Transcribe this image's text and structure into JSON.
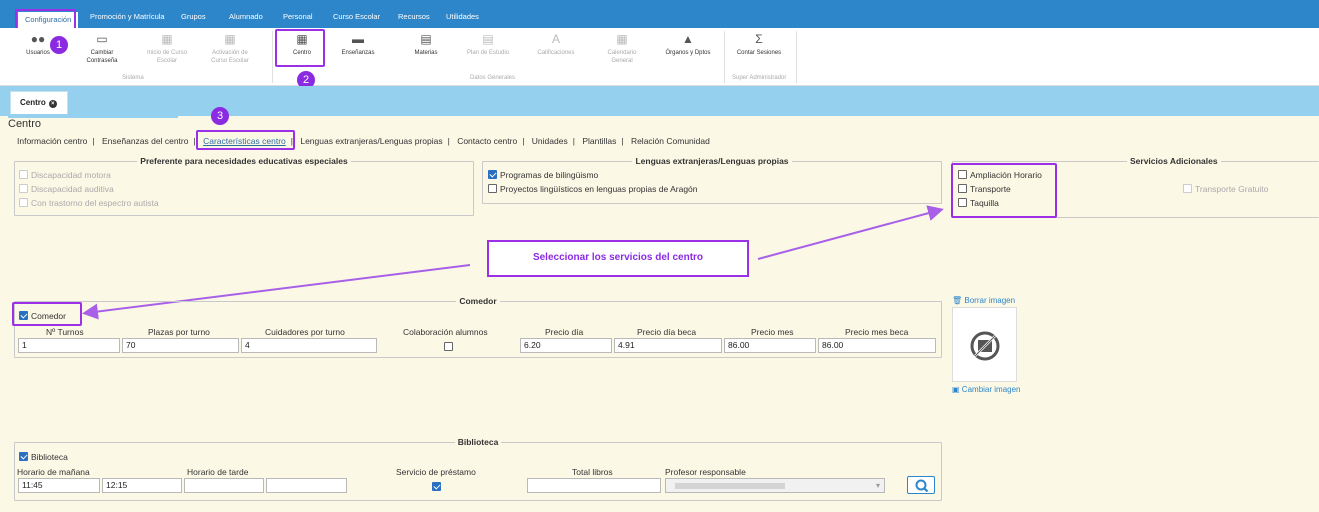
{
  "menu": {
    "items": [
      "Configuración",
      "Promoción y Matrícula",
      "Grupos",
      "Alumnado",
      "Personal",
      "Curso Escolar",
      "Recursos",
      "Utilidades"
    ]
  },
  "ribbon": {
    "usuarios": "Usuarios",
    "cambiar": [
      "Cambiar",
      "Contraseña"
    ],
    "inicio": [
      "Inicio de Curso",
      "Escolar"
    ],
    "activacion": [
      "Activación de",
      "Curso Escolar"
    ],
    "centro": "Centro",
    "ensenanzas": "Enseñanzas",
    "materias": "Materias",
    "plan": "Plan de Estudio",
    "calificaciones": "Calificaciones",
    "calendario": [
      "Calendario",
      "General"
    ],
    "organos": "Órganos y Dptos",
    "contar": "Contar Sesiones",
    "group_sistema": "Sistema",
    "group_datos": "Datos Generales",
    "group_super": "Super Administrador"
  },
  "annotations": {
    "step1": "1",
    "step2": "2",
    "step3": "3",
    "callout": "Seleccionar los servicios del centro"
  },
  "tab": {
    "label": "Centro"
  },
  "page": {
    "title": "Centro"
  },
  "subtabs": [
    "Información centro",
    "Enseñanzas del centro",
    "Características centro",
    "Lenguas extranjeras/Lenguas propias",
    "Contacto centro",
    "Unidades",
    "Plantillas",
    "Relación Comunidad"
  ],
  "nee": {
    "legend": "Preferente para necesidades educativas especiales",
    "items": [
      "Discapacidad motora",
      "Discapacidad auditiva",
      "Con trastorno del espectro autista"
    ]
  },
  "lenguas": {
    "legend": "Lenguas extranjeras/Lenguas propias",
    "items": [
      "Programas de bilingüismo",
      "Proyectos lingüísticos en lenguas propias de Aragón"
    ],
    "checked": [
      true,
      false
    ]
  },
  "servicios": {
    "legend": "Servicios Adicionales",
    "items": [
      "Ampliación Horario",
      "Transporte",
      "Taquilla"
    ],
    "transporte_gratuito": "Transporte Gratuito"
  },
  "comedor": {
    "legend": "Comedor",
    "checkbox": "Comedor",
    "labels": [
      "Nº Turnos",
      "Plazas por turno",
      "Cuidadores por turno",
      "Colaboración alumnos",
      "Precio día",
      "Precio día beca",
      "Precio mes",
      "Precio mes beca"
    ],
    "values": {
      "turnos": "1",
      "plazas": "70",
      "cuidadores": "4",
      "precio_dia": "6.20",
      "precio_dia_beca": "4.91",
      "precio_mes": "86.00",
      "precio_mes_beca": "86.00"
    }
  },
  "imagen": {
    "borrar": "Borrar imagen",
    "cambiar": "Cambiar imagen"
  },
  "biblioteca": {
    "legend": "Biblioteca",
    "checkbox": "Biblioteca",
    "labels": [
      "Horario de mañana",
      "Horario de tarde",
      "Servicio de préstamo",
      "Total libros",
      "Profesor responsable"
    ],
    "values": {
      "manana_desde": "11:45",
      "manana_hasta": "12:15",
      "tarde_desde": "",
      "tarde_hasta": "",
      "total_libros": ""
    }
  },
  "colors": {
    "topbar": "#2d86c9",
    "tabstrip": "#95d0ee",
    "content_bg": "#fcf8e6",
    "highlight": "#9b30e6",
    "checkbox_on": "#2a6fc1"
  }
}
